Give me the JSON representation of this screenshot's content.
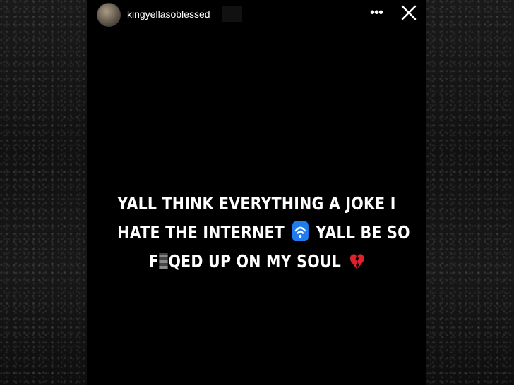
{
  "story": {
    "username": "kingyellasoblessed",
    "more_icon": "more-icon",
    "close_icon": "close-icon"
  },
  "caption": {
    "line1": "YALL THINK EVERYTHING  A JOKE I",
    "line2_a": "HATE THE INTERNET",
    "line2_b": "YALL BE SO",
    "line3_a": "F",
    "line3_b": "QED UP ON MY SOUL"
  },
  "colors": {
    "background": "#000000",
    "text": "#ffffff",
    "wifi_emoji": "#1e7cf0",
    "heart_emoji": "#e0202a"
  }
}
